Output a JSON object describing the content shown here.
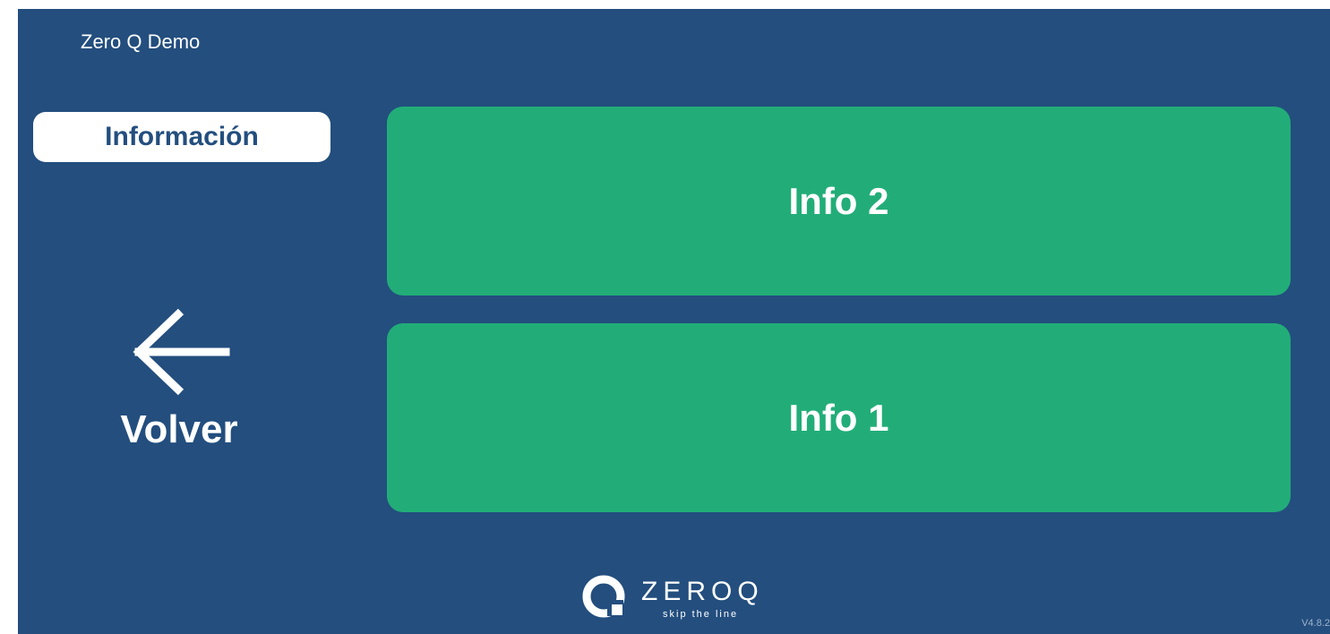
{
  "app": {
    "title": "Zero Q Demo",
    "version": "V4.8.2"
  },
  "section_tab": {
    "label": "Información"
  },
  "back_button": {
    "label": "Volver",
    "icon": "arrow-left-icon"
  },
  "options": [
    {
      "label": "Info 2"
    },
    {
      "label": "Info 1"
    }
  ],
  "brand": {
    "name": "ZEROQ",
    "tagline": "skip the line",
    "icon": "zeroq-logo-icon"
  },
  "colors": {
    "background": "#234e7e",
    "option_button": "#22ad78",
    "tab_background": "#ffffff",
    "tab_text": "#234e7e",
    "text": "#ffffff"
  }
}
